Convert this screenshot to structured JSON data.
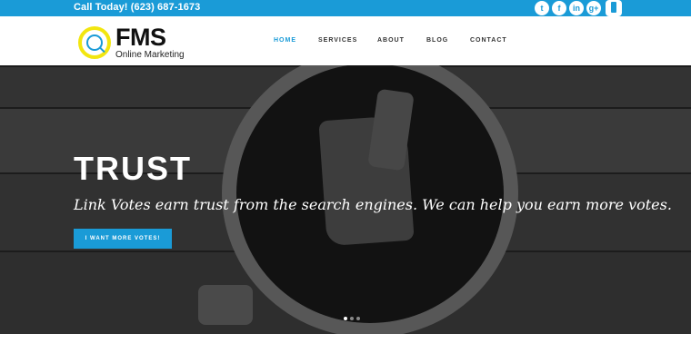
{
  "topbar": {
    "phone": "Call Today! (623) 687-1673",
    "social": [
      {
        "name": "twitter-icon",
        "glyph": "t"
      },
      {
        "name": "facebook-icon",
        "glyph": "f"
      },
      {
        "name": "linkedin-icon",
        "glyph": "in"
      },
      {
        "name": "google-plus-icon",
        "glyph": "g+"
      }
    ],
    "mobile_icon": "mobile-phone-icon",
    "accent_color": "#1a9bd7"
  },
  "header": {
    "logo_title": "FMS",
    "logo_subtitle": "Online Marketing",
    "logo_ring_color": "#f2e60f",
    "nav": [
      "HOME",
      "SERVICES",
      "ABOUT",
      "BLOG",
      "CONTACT"
    ],
    "active_nav": "HOME"
  },
  "hero": {
    "title": "TRUST",
    "subtitle": "Link Votes earn trust from the search engines. We can help you earn more votes.",
    "button_label": "I WANT MORE VOTES!",
    "slides": 3,
    "active_slide": 1
  }
}
